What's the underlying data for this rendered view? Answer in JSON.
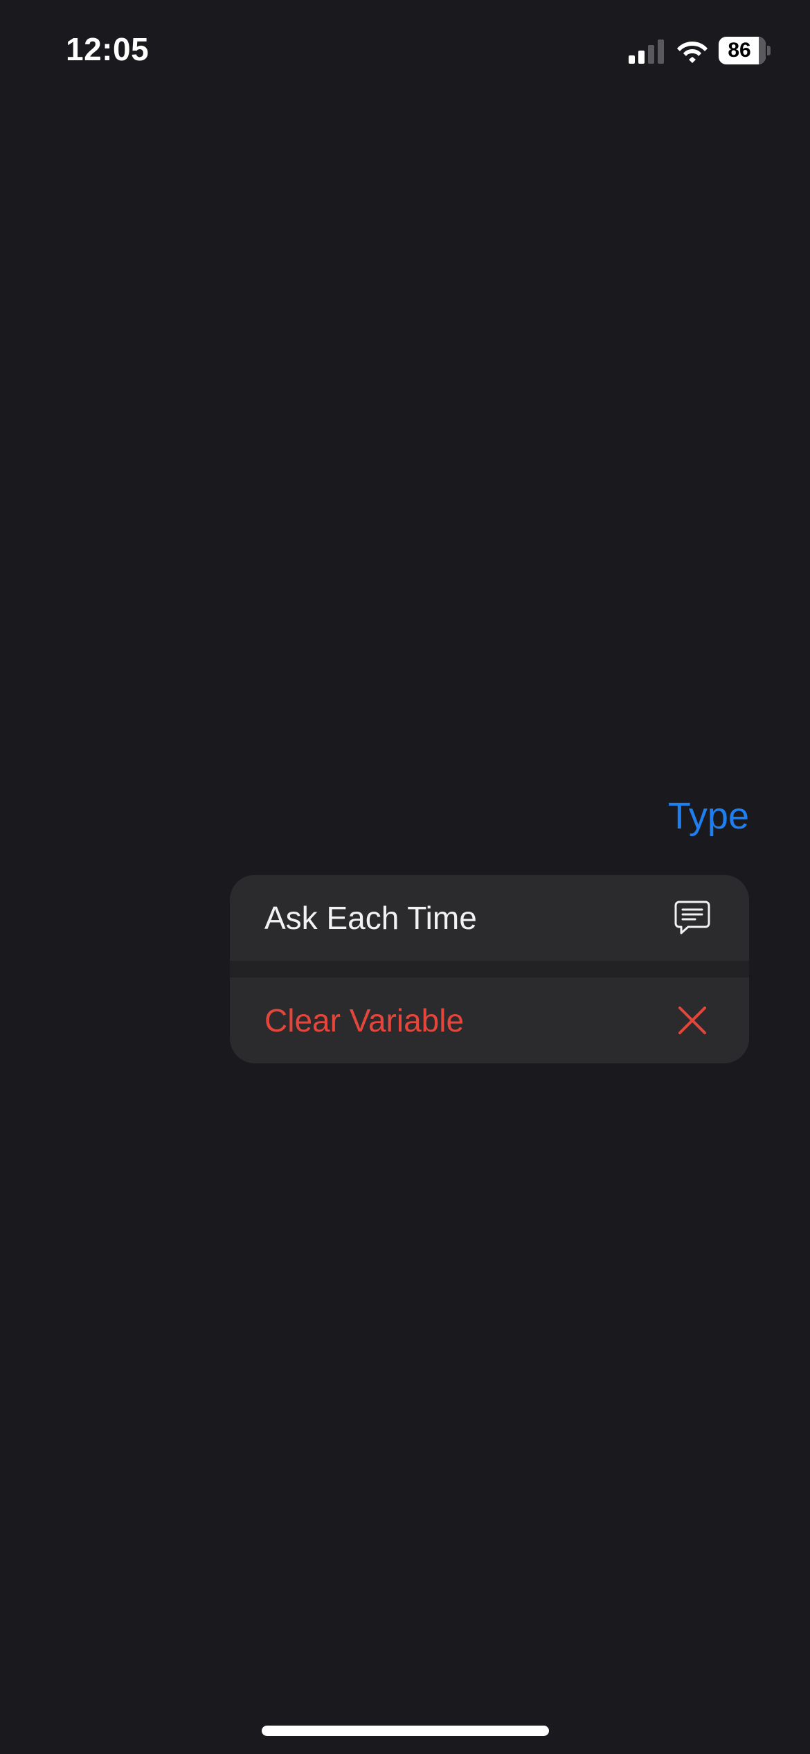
{
  "status_bar": {
    "time": "12:05",
    "battery_level": "86",
    "signal_icon": "cellular-signal-icon",
    "wifi_icon": "wifi-icon",
    "battery_icon": "battery-icon"
  },
  "header": {
    "type_label": "Type"
  },
  "menu": {
    "items": [
      {
        "label": "Ask Each Time",
        "icon": "speech-bubble-icon",
        "color": "#f2f2f2"
      },
      {
        "label": "Clear Variable",
        "icon": "x-mark-icon",
        "color": "#e5463b"
      }
    ]
  },
  "colors": {
    "background": "#1a1a1e",
    "menu_background": "#2b2b2e",
    "accent": "#1f7ff0",
    "destructive": "#e5463b"
  }
}
